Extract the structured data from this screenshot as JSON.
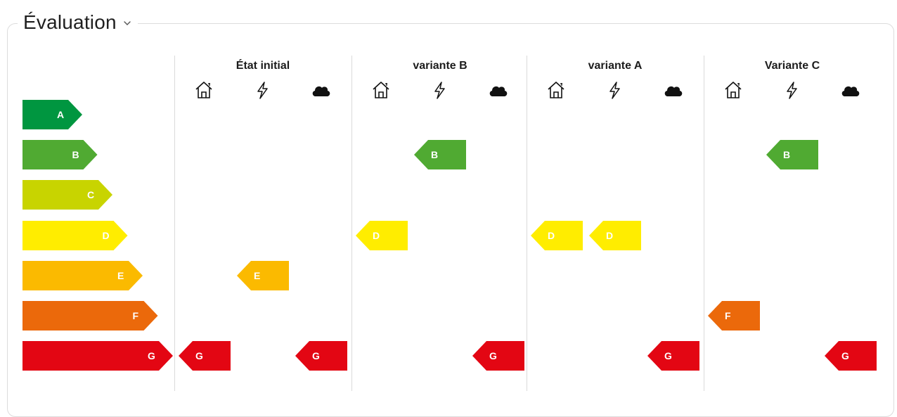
{
  "panel": {
    "title": "Évaluation"
  },
  "icons": {
    "building": "house-icon",
    "energy": "lightning-icon",
    "climate": "cloud-icon"
  },
  "scale": [
    {
      "label": "A",
      "color": "#009640"
    },
    {
      "label": "B",
      "color": "#50AA32"
    },
    {
      "label": "C",
      "color": "#C8D400"
    },
    {
      "label": "D",
      "color": "#FFED00"
    },
    {
      "label": "E",
      "color": "#FBBA00"
    },
    {
      "label": "F",
      "color": "#EB690B"
    },
    {
      "label": "G",
      "color": "#E30613"
    }
  ],
  "columns": [
    {
      "title": "État initial",
      "ratings": {
        "building": "G",
        "energy": "E",
        "climate": "G"
      }
    },
    {
      "title": "variante B",
      "ratings": {
        "building": "D",
        "energy": "B",
        "climate": "G"
      }
    },
    {
      "title": "variante A",
      "ratings": {
        "building": "D",
        "energy": "D",
        "climate": "G"
      }
    },
    {
      "title": "Variante C",
      "ratings": {
        "building": "F",
        "energy": "B",
        "climate": "G"
      }
    }
  ]
}
